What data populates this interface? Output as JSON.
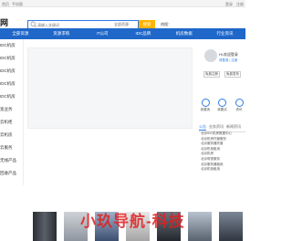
{
  "topbar": {
    "home_label": "首页",
    "fav_label": "手机版",
    "right_links": [
      "登录",
      "注册"
    ]
  },
  "logo": "网",
  "search": {
    "placeholder": "请输入关键词",
    "category": "全部资源",
    "button": "搜索",
    "hot_label": "热搜："
  },
  "nav": [
    "全部资源",
    "资源求购",
    "IT公司",
    "IDC品牌",
    "机房数据",
    "行业资讯"
  ],
  "sidebar": [
    "IDC机房",
    "IDC机房",
    "IDC机房",
    "IDC机房",
    "IDC机房",
    "宽业务",
    "云机柜",
    "云机房",
    "云服务",
    "无线产品",
    "回收产品"
  ],
  "user_card": {
    "greeting": "Hi,欢迎登录",
    "login_link": "请登录 | 注册",
    "buttons": [
      "免费注册",
      "免费发布"
    ]
  },
  "quick_icons": [
    {
      "label": "我要卖",
      "icon": "shop-icon"
    },
    {
      "label": "我要买",
      "icon": "cart-icon"
    },
    {
      "label": "资讯",
      "icon": "news-icon"
    }
  ],
  "tabs": [
    "公告",
    "业务资讯",
    "新闻资讯"
  ],
  "news": [
    "北京IDC机房数据中心",
    "北京机房托管服务",
    "北京服务器托管",
    "北京机柜租用",
    "北京机房",
    "北京带宽服务",
    "北京服务器租用",
    "北京机柜租用"
  ],
  "watermark": "小玖导航-科技",
  "colors": {
    "nav": "#1f67c9",
    "search_button": "#ffb400",
    "accent": "#2c7be5"
  }
}
